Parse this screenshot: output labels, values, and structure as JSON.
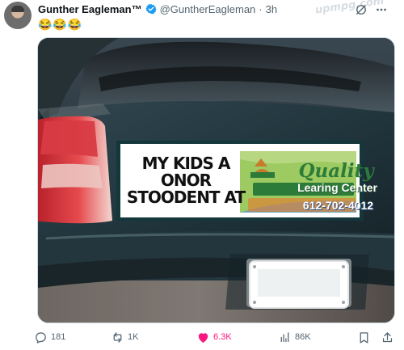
{
  "tweet": {
    "display_name": "Gunther Eagleman™",
    "handle": "@GuntherEagleman",
    "separator": "·",
    "time": "3h",
    "text": "😂😂😂",
    "watermark": "upmpg.com"
  },
  "image": {
    "sticker_left": "MY KIDS A ONOR STOODENT AT",
    "logo_title": "Quality",
    "logo_subtitle": "Learing Center",
    "logo_phone": "612-702-4012"
  },
  "actions": {
    "replies": "181",
    "reposts": "1K",
    "likes": "6.3K",
    "views": "86K"
  },
  "colors": {
    "text": "#0f1419",
    "muted": "#536471",
    "verified": "#1d9bf0",
    "like_pink": "#f91880"
  },
  "icons": {
    "verified": "verified-badge-icon",
    "grok": "grok-icon",
    "more": "more-icon",
    "reply": "reply-icon",
    "repost": "repost-icon",
    "like": "heart-icon",
    "views": "views-icon",
    "bookmark": "bookmark-icon"
  }
}
